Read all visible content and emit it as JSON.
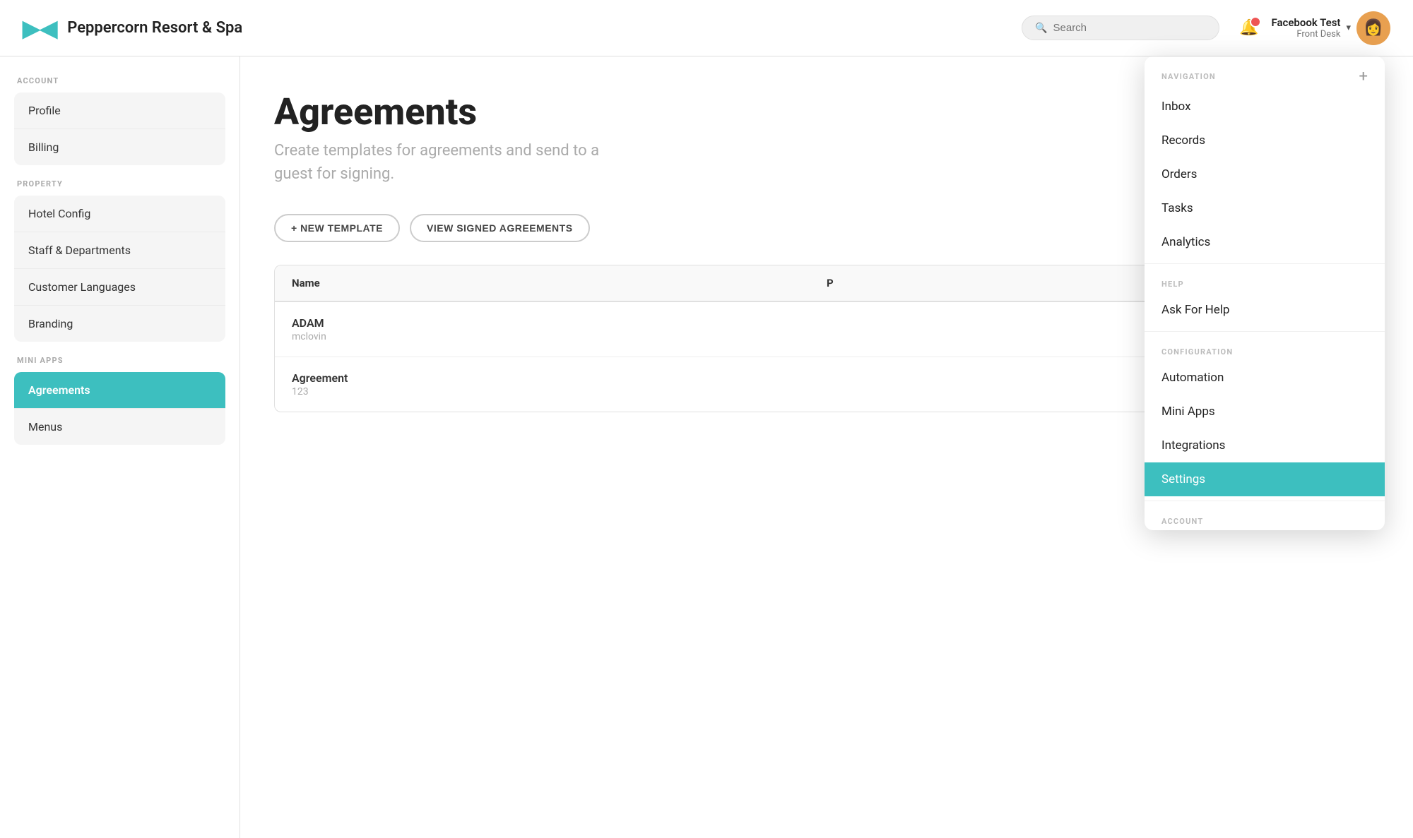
{
  "header": {
    "logo_text": "▶◀",
    "app_title": "Peppercorn Resort & Spa",
    "search_placeholder": "Search",
    "user_name": "Facebook Test",
    "user_role": "Front Desk",
    "chevron": "▾"
  },
  "sidebar": {
    "sections": [
      {
        "label": "ACCOUNT",
        "items": [
          {
            "id": "profile",
            "label": "Profile",
            "active": false
          },
          {
            "id": "billing",
            "label": "Billing",
            "active": false
          }
        ]
      },
      {
        "label": "PROPERTY",
        "items": [
          {
            "id": "hotel-config",
            "label": "Hotel Config",
            "active": false
          },
          {
            "id": "staff-departments",
            "label": "Staff & Departments",
            "active": false
          },
          {
            "id": "customer-languages",
            "label": "Customer Languages",
            "active": false
          },
          {
            "id": "branding",
            "label": "Branding",
            "active": false
          }
        ]
      },
      {
        "label": "MINI APPS",
        "items": [
          {
            "id": "agreements",
            "label": "Agreements",
            "active": true
          },
          {
            "id": "menus",
            "label": "Menus",
            "active": false
          }
        ]
      }
    ]
  },
  "content": {
    "page_title": "Agreements",
    "page_subtitle": "Create templates for agreements and send to a\nguest for signing.",
    "buttons": [
      {
        "id": "new-template",
        "label": "+ NEW TEMPLATE"
      },
      {
        "id": "view-signed",
        "label": "VIEW SIGNED AGREEMENTS"
      }
    ],
    "table": {
      "columns": [
        "Name",
        "P"
      ],
      "rows": [
        {
          "id": "adam",
          "name": "ADAM",
          "sub": "mclovin"
        },
        {
          "id": "agreement",
          "name": "Agreement",
          "sub": "123"
        }
      ]
    }
  },
  "dropdown": {
    "sections": [
      {
        "label": "NAVIGATION",
        "show_plus": true,
        "items": [
          {
            "id": "inbox",
            "label": "Inbox",
            "active": false
          },
          {
            "id": "records",
            "label": "Records",
            "active": false
          },
          {
            "id": "orders",
            "label": "Orders",
            "active": false
          },
          {
            "id": "tasks",
            "label": "Tasks",
            "active": false
          },
          {
            "id": "analytics",
            "label": "Analytics",
            "active": false
          }
        ]
      },
      {
        "label": "HELP",
        "show_plus": false,
        "items": [
          {
            "id": "ask-for-help",
            "label": "Ask For Help",
            "active": false
          }
        ]
      },
      {
        "label": "CONFIGURATION",
        "show_plus": false,
        "items": [
          {
            "id": "automation",
            "label": "Automation",
            "active": false
          },
          {
            "id": "mini-apps",
            "label": "Mini Apps",
            "active": false
          },
          {
            "id": "integrations",
            "label": "Integrations",
            "active": false
          },
          {
            "id": "settings",
            "label": "Settings",
            "active": true
          }
        ]
      },
      {
        "label": "ACCOUNT",
        "show_plus": false,
        "items": []
      }
    ]
  }
}
